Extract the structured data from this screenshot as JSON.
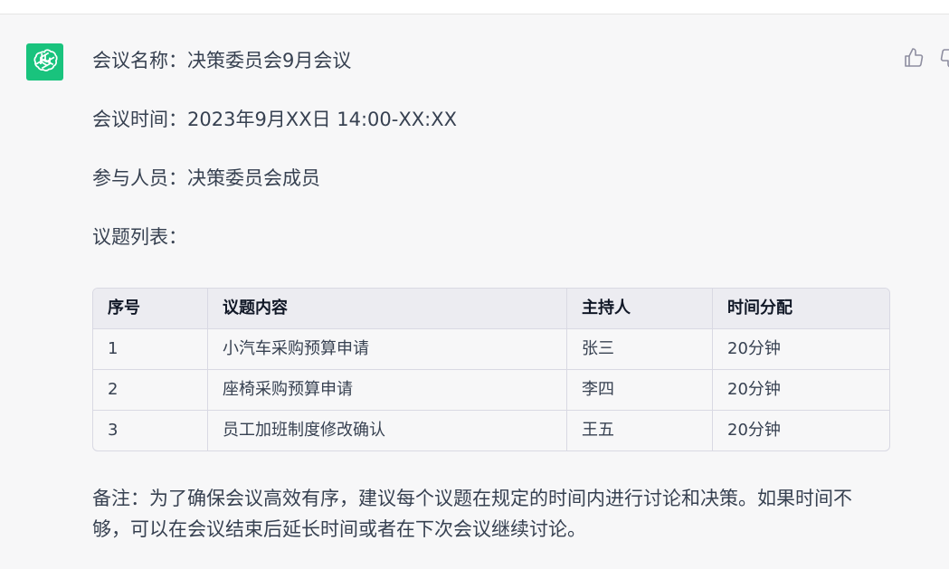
{
  "message": {
    "meeting_name": "会议名称：决策委员会9月会议",
    "meeting_time": "会议时间：2023年9月XX日 14:00-XX:XX",
    "participants": "参与人员：决策委员会成员",
    "agenda_heading": "议题列表："
  },
  "table": {
    "headers": [
      "序号",
      "议题内容",
      "主持人",
      "时间分配"
    ],
    "rows": [
      [
        "1",
        "小汽车采购预算申请",
        "张三",
        "20分钟"
      ],
      [
        "2",
        "座椅采购预算申请",
        "李四",
        "20分钟"
      ],
      [
        "3",
        "员工加班制度修改确认",
        "王五",
        "20分钟"
      ]
    ]
  },
  "note": "备注：为了确保会议高效有序，建议每个议题在规定的时间内进行讨论和决策。如果时间不够，可以在会议结束后延长时间或者在下次会议继续讨论。",
  "icons": {
    "avatar": "openai-logo-icon",
    "like": "thumbs-up-icon",
    "dislike": "thumbs-down-icon"
  },
  "colors": {
    "avatar_bg": "#19c37d",
    "page_bg": "#f7f7f8",
    "text": "#374151"
  }
}
